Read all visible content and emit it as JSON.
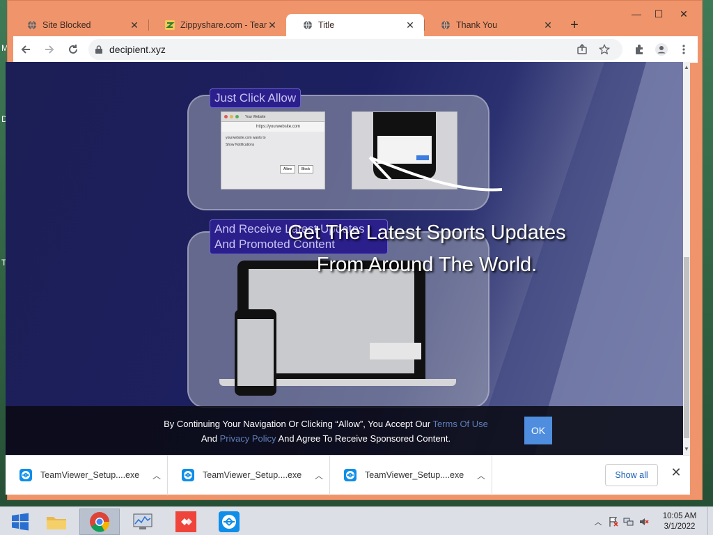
{
  "desktop": {
    "letters": [
      "M",
      "D",
      "T"
    ]
  },
  "window": {
    "minimize": "—",
    "maximize": "☐",
    "close": "✕"
  },
  "tabs": [
    {
      "label": "Site Blocked",
      "icon": "globe-icon",
      "close": "✕"
    },
    {
      "label": "Zippyshare.com - TeamV",
      "icon": "zippyshare-favicon",
      "close": "✕"
    },
    {
      "label": "Title",
      "icon": "globe-icon",
      "close": "✕",
      "active": true
    },
    {
      "label": "Thank You",
      "icon": "globe-icon",
      "close": "✕"
    }
  ],
  "new_tab": "+",
  "toolbar": {
    "url": "decipient.xyz",
    "icons": [
      "back-icon",
      "forward-icon",
      "reload-icon",
      "lock-icon",
      "share-icon",
      "star-icon",
      "extensions-icon",
      "profile-icon",
      "menu-icon"
    ]
  },
  "page": {
    "card1_label": "Just Click Allow",
    "card2_label_line1": "And Receive Latest Updates",
    "card2_label_line2": "And Promoted Content",
    "headline_line1": "Get The Latest Sports Updates",
    "headline_line2": "From Around The World.",
    "consent": {
      "part1": "By Continuing Your Navigation Or Clicking “Allow”, You Accept Our ",
      "link1": "Terms Of Use",
      "part2": "And ",
      "link2": "Privacy Policy",
      "part3": " And Agree To Receive Sponsored Content.",
      "ok": "OK"
    },
    "mini_browser": {
      "site": "Your Website",
      "url": "https://yourwebsite.com",
      "text": "yourwebsite.com wants to",
      "option": "Show Notifications",
      "allow": "Allow",
      "block": "Block"
    }
  },
  "downloads": {
    "items": [
      {
        "label": "TeamViewer_Setup....exe"
      },
      {
        "label": "TeamViewer_Setup....exe"
      },
      {
        "label": "TeamViewer_Setup....exe"
      }
    ],
    "show_all": "Show all",
    "close": "✕"
  },
  "taskbar": {
    "apps": [
      "windows-start-icon",
      "file-explorer-icon",
      "chrome-icon",
      "performance-monitor-icon",
      "anydesk-icon",
      "teamviewer-icon"
    ],
    "time": "10:05 AM",
    "date": "3/1/2022"
  },
  "colors": {
    "window_frame": "#f0956b",
    "page_bg": "#1d2060",
    "accent": "#4f8ede"
  }
}
